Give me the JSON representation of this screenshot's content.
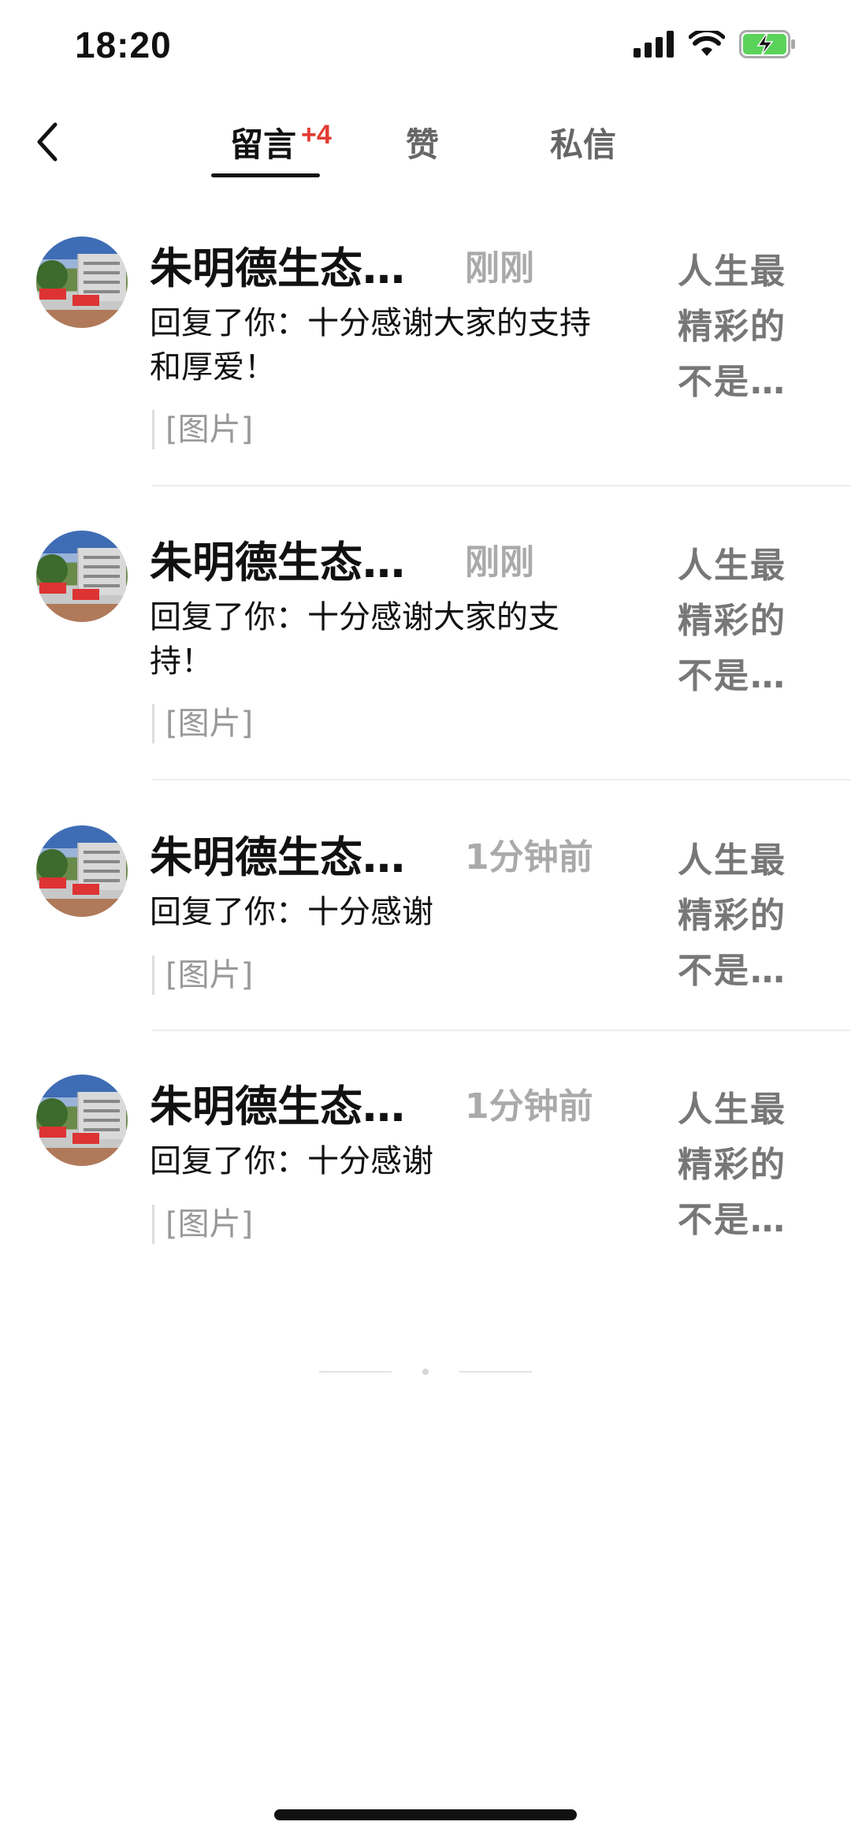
{
  "status_bar": {
    "time": "18:20",
    "icons": [
      "signal-icon",
      "wifi-icon",
      "battery-charging-icon"
    ],
    "battery_color": "#5bd35b"
  },
  "nav": {
    "tabs": [
      {
        "label": "留言",
        "badge": "+4",
        "active": true
      },
      {
        "label": "赞",
        "active": false
      },
      {
        "label": "私信",
        "active": false
      }
    ],
    "badge_color": "#e23d33"
  },
  "messages": [
    {
      "name": "朱明德生态…",
      "time": "刚刚",
      "reply": "回复了你：十分感谢大家的支持和厚爱！",
      "attachment": "[图片]",
      "preview": "人生最精彩的不是…"
    },
    {
      "name": "朱明德生态…",
      "time": "刚刚",
      "reply": "回复了你：十分感谢大家的支持！",
      "attachment": "[图片]",
      "preview": "人生最精彩的不是…"
    },
    {
      "name": "朱明德生态…",
      "time": "1分钟前",
      "reply": "回复了你：十分感谢",
      "attachment": "[图片]",
      "preview": "人生最精彩的不是…"
    },
    {
      "name": "朱明德生态…",
      "time": "1分钟前",
      "reply": "回复了你：十分感谢",
      "attachment": "[图片]",
      "preview": "人生最精彩的不是…"
    }
  ]
}
